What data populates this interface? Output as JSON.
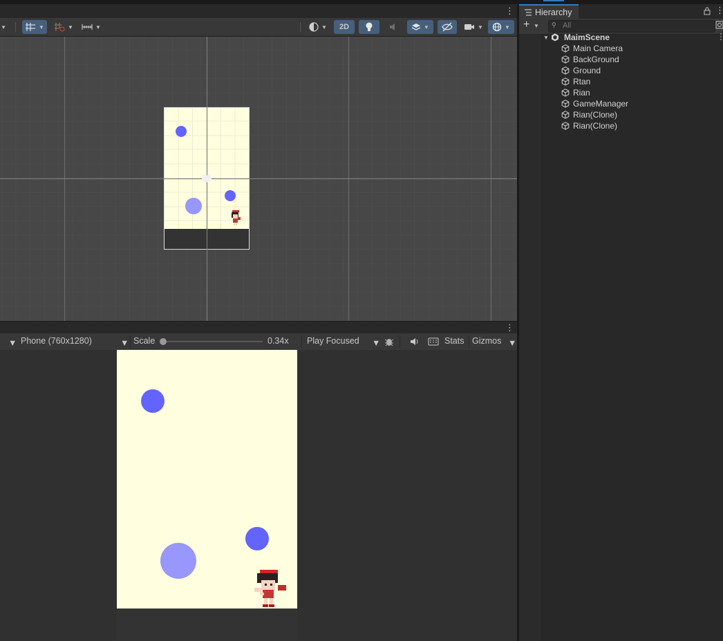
{
  "scene_toolbar": {
    "mode_2d_label": "2D"
  },
  "game_toolbar": {
    "display_dropdown_label": "Phone (760x1280)",
    "scale_label": "Scale",
    "scale_value": "0.34x",
    "scale_fraction": 0.0,
    "play_mode_label": "Play Focused",
    "stats_label": "Stats",
    "gizmos_label": "Gizmos"
  },
  "hierarchy": {
    "tab_label": "Hierarchy",
    "search_placeholder": "All",
    "scene_name": "MaimScene",
    "items": [
      {
        "label": "Main Camera"
      },
      {
        "label": "BackGround"
      },
      {
        "label": "Ground"
      },
      {
        "label": "Rtan"
      },
      {
        "label": "Rian"
      },
      {
        "label": "GameManager"
      },
      {
        "label": "Rian(Clone)"
      },
      {
        "label": "Rian(Clone)"
      }
    ]
  },
  "colors": {
    "background_fill": "#ffffe0",
    "ground_fill": "#333333",
    "ball_dark": "#6363fd",
    "ball_light": "#9797fe",
    "accent": "#46607c"
  }
}
